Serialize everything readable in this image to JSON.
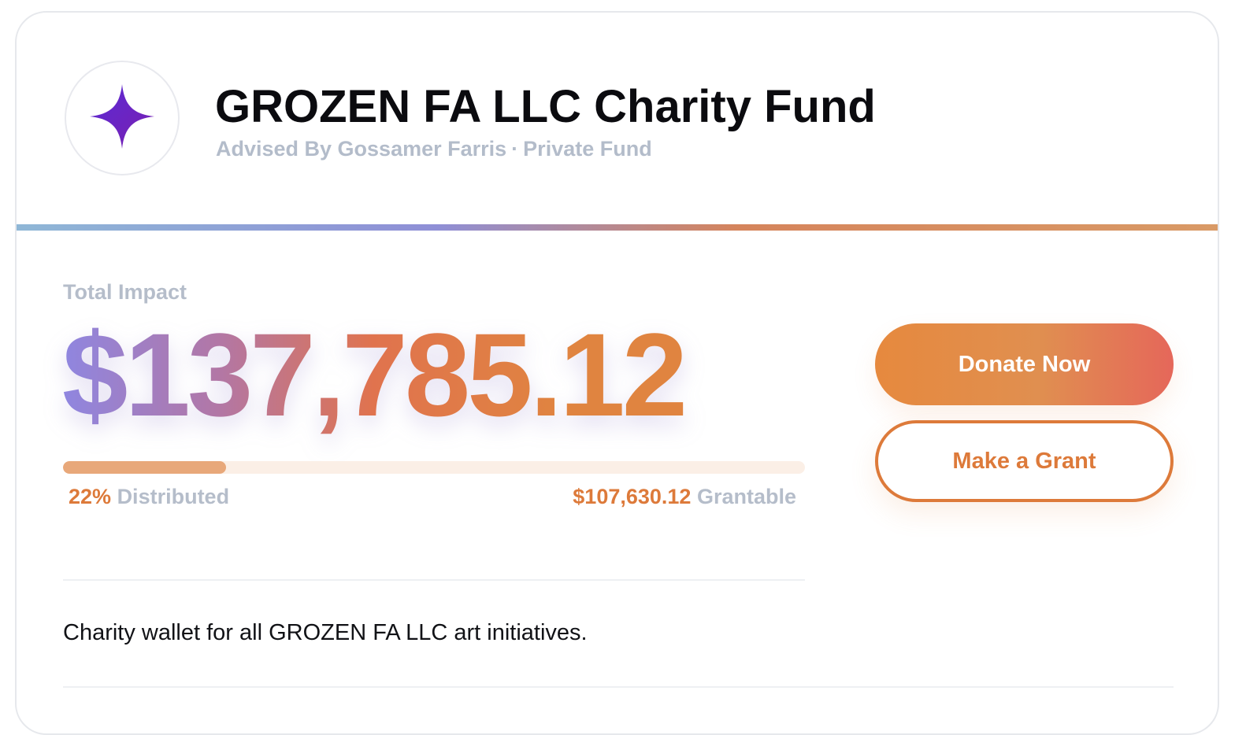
{
  "fund": {
    "name": "GROZEN FA LLC Charity Fund",
    "advised_by": "Advised By Gossamer Farris",
    "separator": "·",
    "fund_type": "Private Fund",
    "avatar_icon": "sparkle-star-icon"
  },
  "impact": {
    "label": "Total Impact",
    "amount": "$137,785.12",
    "distributed_percent": 22,
    "distributed_value": "22%",
    "distributed_label": "Distributed",
    "grantable_value": "$107,630.12",
    "grantable_label": "Grantable"
  },
  "actions": {
    "donate_label": "Donate Now",
    "grant_label": "Make a Grant"
  },
  "description": "Charity wallet for all GROZEN FA LLC art initiatives.",
  "colors": {
    "accent": "#dd7a3a",
    "muted": "#b5bdca",
    "star_dark": "#3a0ca3",
    "star_light": "#9d4edd"
  }
}
